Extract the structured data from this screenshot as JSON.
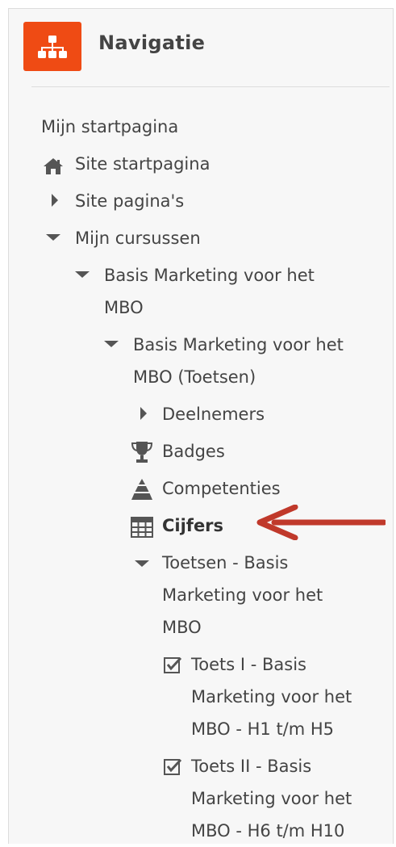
{
  "block": {
    "title": "Navigatie",
    "icon": "sitemap-icon",
    "accent": "#ef4b14"
  },
  "tree": {
    "mijn_startpagina": "Mijn startpagina",
    "site_startpagina": "Site startpagina",
    "site_paginas": "Site pagina's",
    "mijn_cursussen": "Mijn cursussen",
    "course": {
      "line1": "Basis Marketing voor het",
      "line2": "MBO"
    },
    "course_section": {
      "line1": "Basis Marketing voor het",
      "line2": "MBO (Toetsen)"
    },
    "deelnemers": "Deelnemers",
    "badges": "Badges",
    "competenties": "Competenties",
    "cijfers": "Cijfers",
    "toetsen": {
      "line1": "Toetsen - Basis",
      "line2": "Marketing voor het",
      "line3": "MBO"
    },
    "toets1": {
      "line1": "Toets I - Basis",
      "line2": "Marketing voor het",
      "line3": "MBO - H1 t/m H5"
    },
    "toets2": {
      "line1": "Toets II - Basis",
      "line2": "Marketing voor het",
      "line3": "MBO - H6 t/m H10"
    }
  },
  "annotation": {
    "arrow_color": "#c0392b",
    "points_to": "cijfers"
  }
}
